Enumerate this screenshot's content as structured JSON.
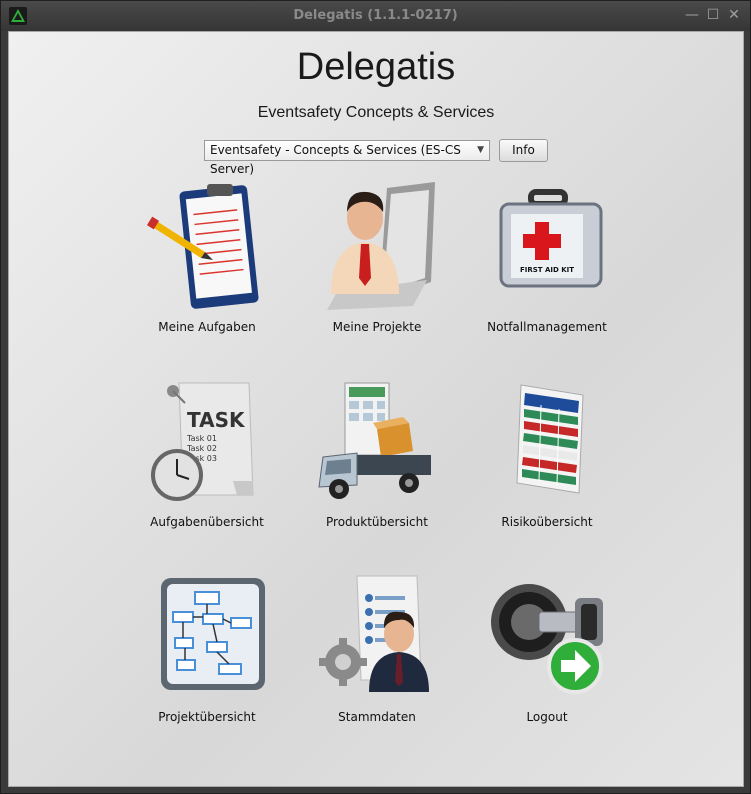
{
  "window": {
    "title": "Delegatis (1.1.1-0217)",
    "controls": {
      "minimize": "—",
      "maximize": "☐",
      "close": "✕"
    }
  },
  "header": {
    "app_name": "Delegatis",
    "subtitle": "Eventsafety Concepts & Services"
  },
  "server_select": {
    "value": "Eventsafety - Concepts & Services  (ES-CS Server)",
    "arrow": "▼"
  },
  "info_button": {
    "label": "Info"
  },
  "tiles": [
    {
      "label": "Meine Aufgaben",
      "icon": "clipboard-icon"
    },
    {
      "label": "Meine Projekte",
      "icon": "businessman-icon"
    },
    {
      "label": "Notfallmanagement",
      "icon": "first-aid-kit-icon"
    },
    {
      "label": "Aufgabenübersicht",
      "icon": "task-clock-icon"
    },
    {
      "label": "Produktübersicht",
      "icon": "delivery-truck-icon"
    },
    {
      "label": "Risikoübersicht",
      "icon": "spreadsheet-icon"
    },
    {
      "label": "Projektübersicht",
      "icon": "flowchart-icon"
    },
    {
      "label": "Stammdaten",
      "icon": "master-data-icon"
    },
    {
      "label": "Logout",
      "icon": "key-logout-icon"
    }
  ],
  "icon_text": {
    "task_title": "TASK",
    "task_lines": [
      "Task 01",
      "Task 02",
      "Task 03"
    ],
    "first_aid": "FIRST AID KIT"
  },
  "colors": {
    "accent_green": "#2fae3a",
    "red_cross": "#d8161b",
    "title_text": "#8a8a8a"
  }
}
